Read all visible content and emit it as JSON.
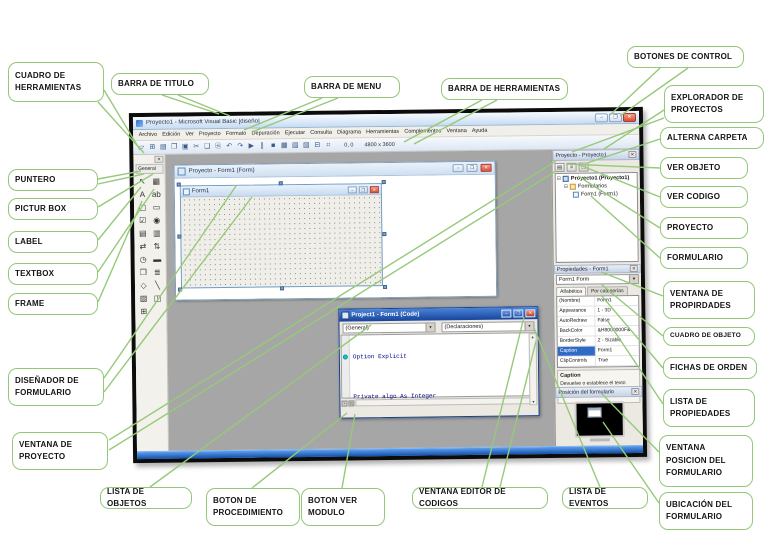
{
  "colors": {
    "callout_green": "#94c879",
    "frame_black": "#0c0c0c",
    "mdi_gray": "#a6a6a6",
    "code_title_blue": "#17459b",
    "selected_row_blue": "#316ac5",
    "breakpoint_cyan": "#0ec3cf",
    "taskbar_blue": "#1150a8"
  },
  "callouts": {
    "cuadro_herramientas": {
      "label": "CUADRO DE HERRAMIENTAS"
    },
    "barra_titulo": {
      "label": "BARRA DE TITULO"
    },
    "barra_menu": {
      "label": "BARRA DE MENU"
    },
    "barra_herramientas": {
      "label": "BARRA DE HERRAMIENTAS"
    },
    "botones_control": {
      "label": "BOTONES DE CONTROL"
    },
    "explorador_proyectos": {
      "label": "EXPLORADOR DE PROYECTOS"
    },
    "alterna_carpeta": {
      "label": "ALTERNA CARPETA"
    },
    "ver_objeto": {
      "label": "VER OBJETO"
    },
    "ver_codigo": {
      "label": "VER CODIGO"
    },
    "proyecto": {
      "label": "PROYECTO"
    },
    "formulario": {
      "label": "FORMULARIO"
    },
    "ventana_propiedades": {
      "label": "VENTANA DE PROPIRDADES"
    },
    "cuadro_objeto": {
      "label": "CUADRO DE OBJETO"
    },
    "fichas_orden": {
      "label": "FICHAS DE ORDEN"
    },
    "lista_propiedades": {
      "label": "LISTA DE PROPIEDADES"
    },
    "ventana_posicion": {
      "label": "VENTANA POSICION DEL FORMULARIO"
    },
    "ubicacion_formulario": {
      "label": "UBICACIÓN DEL FORMULARIO"
    },
    "puntero": {
      "label": "PUNTERO"
    },
    "pictur_box": {
      "label": "PICTUR BOX"
    },
    "label": {
      "label": "LABEL"
    },
    "textbox": {
      "label": "TEXTBOX"
    },
    "frame": {
      "label": "FRAME"
    },
    "disenador_formulario": {
      "label": "DISEÑADOR DE FORMULARIO"
    },
    "ventana_proyecto": {
      "label": "VENTANA DE PROYECTO"
    },
    "lista_objetos": {
      "label": "LISTA DE OBJETOS"
    },
    "boton_procedimiento": {
      "label": "BOTON DE PROCEDIMIENTO"
    },
    "boton_ver_modulo": {
      "label": "BOTON VER MODULO"
    },
    "ventana_editor_codigos": {
      "label": "VENTANA EDITOR DE CODIGOS"
    },
    "lista_eventos": {
      "label": "LISTA DE EVENTOS"
    }
  },
  "vb": {
    "window_title": "Proyecto1 - Microsoft Visual Basic [diseño]",
    "window_buttons": {
      "minimize": "–",
      "maximize": "❐",
      "close": "✕"
    },
    "menu_items": [
      "Archivo",
      "Edición",
      "Ver",
      "Proyecto",
      "Formato",
      "Depuración",
      "Ejecutar",
      "Consulta",
      "Diagrama",
      "Herramientas",
      "Complementos",
      "Ventana",
      "Ayuda"
    ],
    "toolbar": {
      "icons": [
        {
          "name": "add-project-icon",
          "glyph": "▱"
        },
        {
          "name": "add-form-icon",
          "glyph": "⊞"
        },
        {
          "name": "menu-editor-icon",
          "glyph": "▤"
        },
        {
          "name": "open-project-icon",
          "glyph": "❒"
        },
        {
          "name": "save-project-icon",
          "glyph": "▣"
        },
        {
          "name": "cut-icon",
          "glyph": "✂"
        },
        {
          "name": "copy-icon",
          "glyph": "❏"
        },
        {
          "name": "paste-icon",
          "glyph": "⎘"
        },
        {
          "name": "undo-icon",
          "glyph": "↶"
        },
        {
          "name": "redo-icon",
          "glyph": "↷"
        },
        {
          "name": "start-icon",
          "glyph": "▶"
        },
        {
          "name": "break-icon",
          "glyph": "∥"
        },
        {
          "name": "end-icon",
          "glyph": "■"
        },
        {
          "name": "project-explorer-icon",
          "glyph": "▦"
        },
        {
          "name": "properties-window-icon",
          "glyph": "▧"
        },
        {
          "name": "form-layout-icon",
          "glyph": "▨"
        },
        {
          "name": "object-browser-icon",
          "glyph": "⊟"
        },
        {
          "name": "toolbox-icon",
          "glyph": "⌗"
        }
      ],
      "position": "0, 0",
      "size": "4800 x 3600"
    },
    "toolbox": {
      "close_glyph": "✕",
      "tab": "General",
      "tools": [
        {
          "name": "pointer",
          "glyph": "↖"
        },
        {
          "name": "picturebox",
          "glyph": "▦"
        },
        {
          "name": "label",
          "glyph": "A"
        },
        {
          "name": "textbox",
          "glyph": "ab"
        },
        {
          "name": "frame",
          "glyph": "▢"
        },
        {
          "name": "commandbutton",
          "glyph": "▭"
        },
        {
          "name": "checkbox",
          "glyph": "☑"
        },
        {
          "name": "optionbutton",
          "glyph": "◉"
        },
        {
          "name": "combobox",
          "glyph": "▤"
        },
        {
          "name": "listbox",
          "glyph": "▥"
        },
        {
          "name": "hscrollbar",
          "glyph": "⇄"
        },
        {
          "name": "vscrollbar",
          "glyph": "⇅"
        },
        {
          "name": "timer",
          "glyph": "◷"
        },
        {
          "name": "drivelistbox",
          "glyph": "▬"
        },
        {
          "name": "dirlistbox",
          "glyph": "❒"
        },
        {
          "name": "filelistbox",
          "glyph": "≣"
        },
        {
          "name": "shape",
          "glyph": "◇"
        },
        {
          "name": "line",
          "glyph": "╲"
        },
        {
          "name": "image",
          "glyph": "▨"
        },
        {
          "name": "data",
          "glyph": "◫"
        },
        {
          "name": "ole",
          "glyph": "⊞"
        }
      ]
    },
    "designer": {
      "title": "Proyecto - Form1 (Form)",
      "form_title": "Form1",
      "buttons": {
        "minimize": "–",
        "maximize": "❐",
        "close": "✕"
      }
    },
    "code_window": {
      "title": "Project1 - Form1 (Code)",
      "buttons": {
        "minimize": "–",
        "maximize": "❐",
        "close": "✕"
      },
      "object_dropdown": "(General)",
      "event_dropdown": "(Declaraciones)",
      "lines": {
        "0": "Option Explicit",
        "1": "",
        "2": "Private algo As Integer"
      },
      "view_buttons": {
        "procedure": "≡",
        "full_module": "▤"
      }
    },
    "project_explorer": {
      "title": "Proyecto - Proyecto1",
      "close_glyph": "✕",
      "buttons": [
        {
          "name": "view-object",
          "glyph": "▤"
        },
        {
          "name": "view-code",
          "glyph": "≡"
        },
        {
          "name": "toggle-folders",
          "glyph": "❒"
        }
      ],
      "nodes": {
        "root": {
          "expander": "⊟",
          "label": "Proyecto1 (Proyecto1)"
        },
        "folder": {
          "expander": "⊟",
          "label": "Formularios"
        },
        "form": {
          "label": "Form1 (Form1)"
        }
      }
    },
    "properties": {
      "title": "Propiedades - Form1",
      "close_glyph": "✕",
      "object_selector": "Form1 Form",
      "tabs": {
        "alphabetic": "Alfabética",
        "categorized": "Por categorías"
      },
      "rows": [
        {
          "name": "(Nombre)",
          "value": "Form1"
        },
        {
          "name": "Appearance",
          "value": "1 - 3D"
        },
        {
          "name": "AutoRedraw",
          "value": "False"
        },
        {
          "name": "BackColor",
          "value": "&H8000000F&"
        },
        {
          "name": "BorderStyle",
          "value": "2 - Sizable"
        },
        {
          "name": "Caption",
          "value": "Form1",
          "selected": true
        },
        {
          "name": "ClipControls",
          "value": "True"
        }
      ],
      "description_title": "Caption",
      "description": "Devuelve o establece el texto mostrado en la barra de título de un"
    },
    "form_layout": {
      "title": "Posición del formulario",
      "close_glyph": "✕"
    }
  }
}
